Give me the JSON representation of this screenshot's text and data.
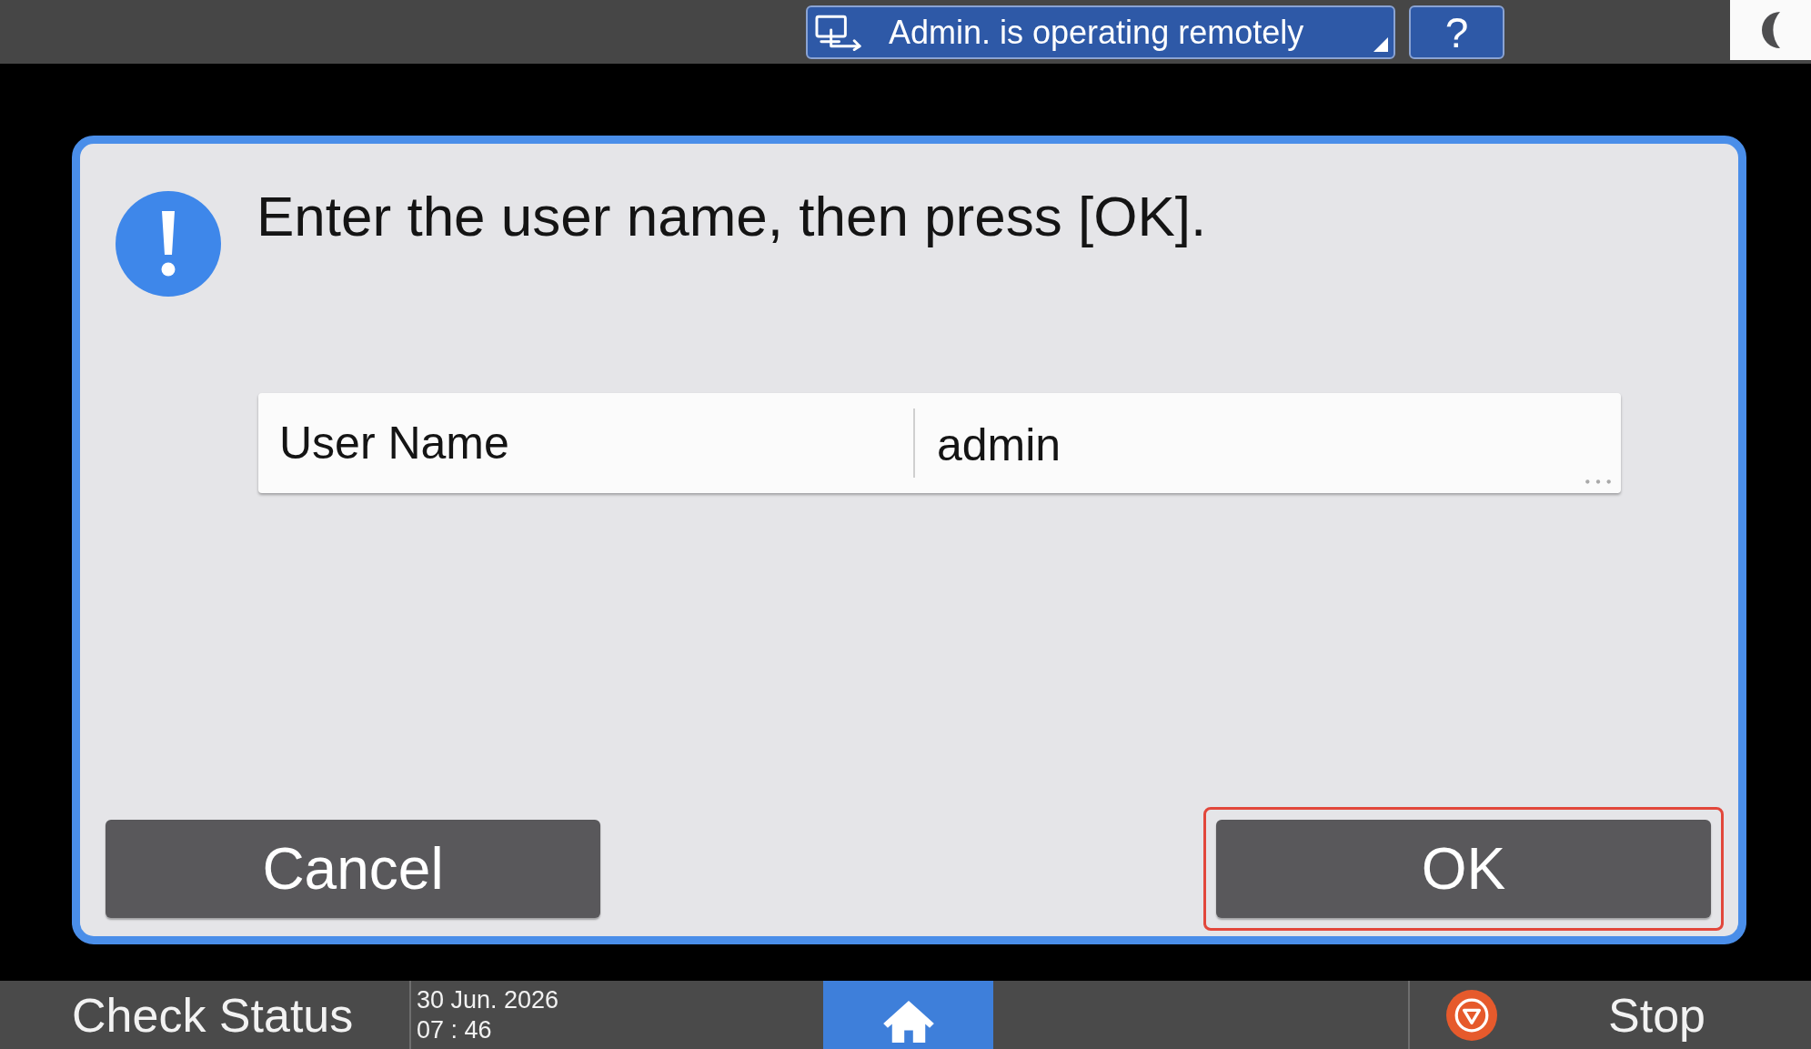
{
  "top_bar": {
    "remote_status": {
      "label": "Admin. is operating remotely"
    },
    "help_button": {
      "label": "?"
    }
  },
  "dialog": {
    "message": "Enter the user name, then press [OK].",
    "field": {
      "label": "User Name",
      "value": "admin"
    },
    "buttons": [
      {
        "label": "Cancel",
        "highlighted": false
      },
      {
        "label": "OK",
        "highlighted": true
      }
    ]
  },
  "bottom_bar": {
    "check_status": "Check Status",
    "date": "30 Jun. 2026",
    "time": "07 : 46",
    "stop": "Stop"
  }
}
